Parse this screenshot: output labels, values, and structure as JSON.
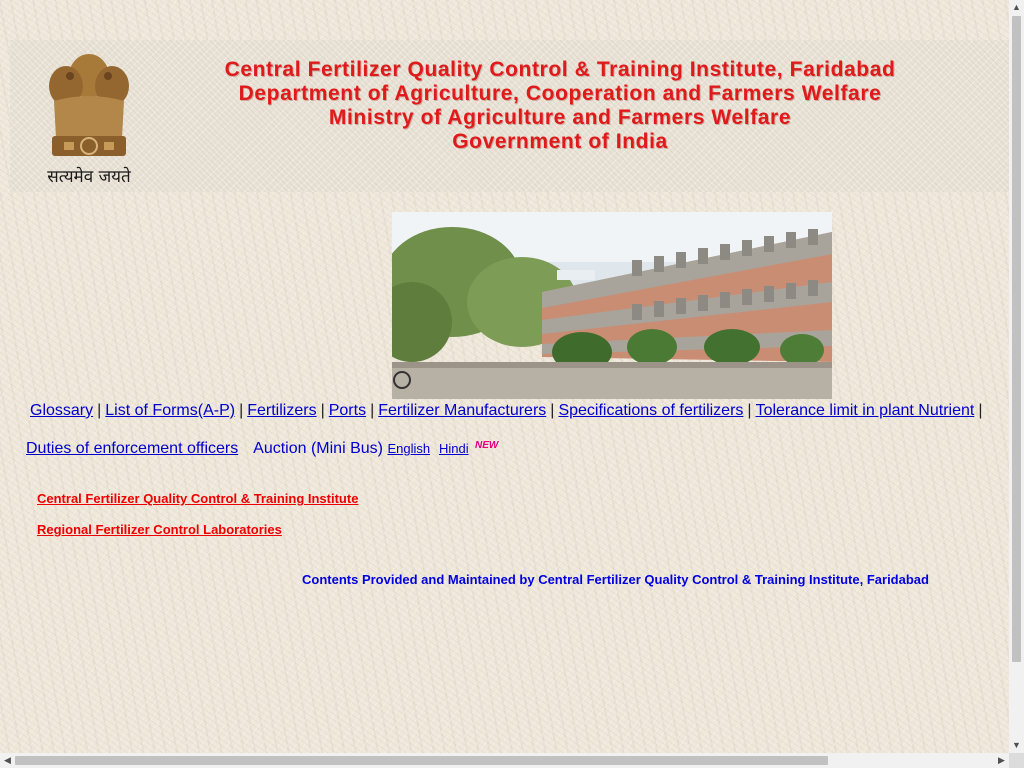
{
  "header": {
    "lines": [
      "Central Fertilizer Quality Control & Training Institute, Faridabad",
      "Department of Agriculture, Cooperation and Farmers Welfare",
      "Ministry of Agriculture and Farmers Welfare",
      "Government of India"
    ],
    "emblem_motto": "सत्यमेव जयते"
  },
  "nav": {
    "row1": [
      {
        "label": "Glossary"
      },
      {
        "label": "List of Forms(A-P)"
      },
      {
        "label": "Fertilizers"
      },
      {
        "label": "Ports"
      },
      {
        "label": "Fertilizer Manufacturers"
      },
      {
        "label": "Specifications of fertilizers"
      },
      {
        "label": "Tolerance limit in plant Nutrient"
      }
    ],
    "separator": "|",
    "duties": "Duties of enforcement officers",
    "auction": "Auction (Mini Bus)",
    "english": "English",
    "hindi": "Hindi",
    "new_badge": "NEW"
  },
  "links": {
    "cfqcti": "Central Fertilizer Quality Control & Training Institute",
    "rfcl": "Regional Fertilizer Control Laboratories"
  },
  "footer": {
    "text": "Contents Provided and Maintained by Central Fertilizer Quality Control & Training Institute, Faridabad"
  },
  "colors": {
    "banner_text": "#e01a1a",
    "link": "#0000cc",
    "red_link": "#ee0000",
    "footer": "#0000e0"
  },
  "icons": {
    "emblem": "national-emblem-icon",
    "new": "new-badge-icon"
  }
}
